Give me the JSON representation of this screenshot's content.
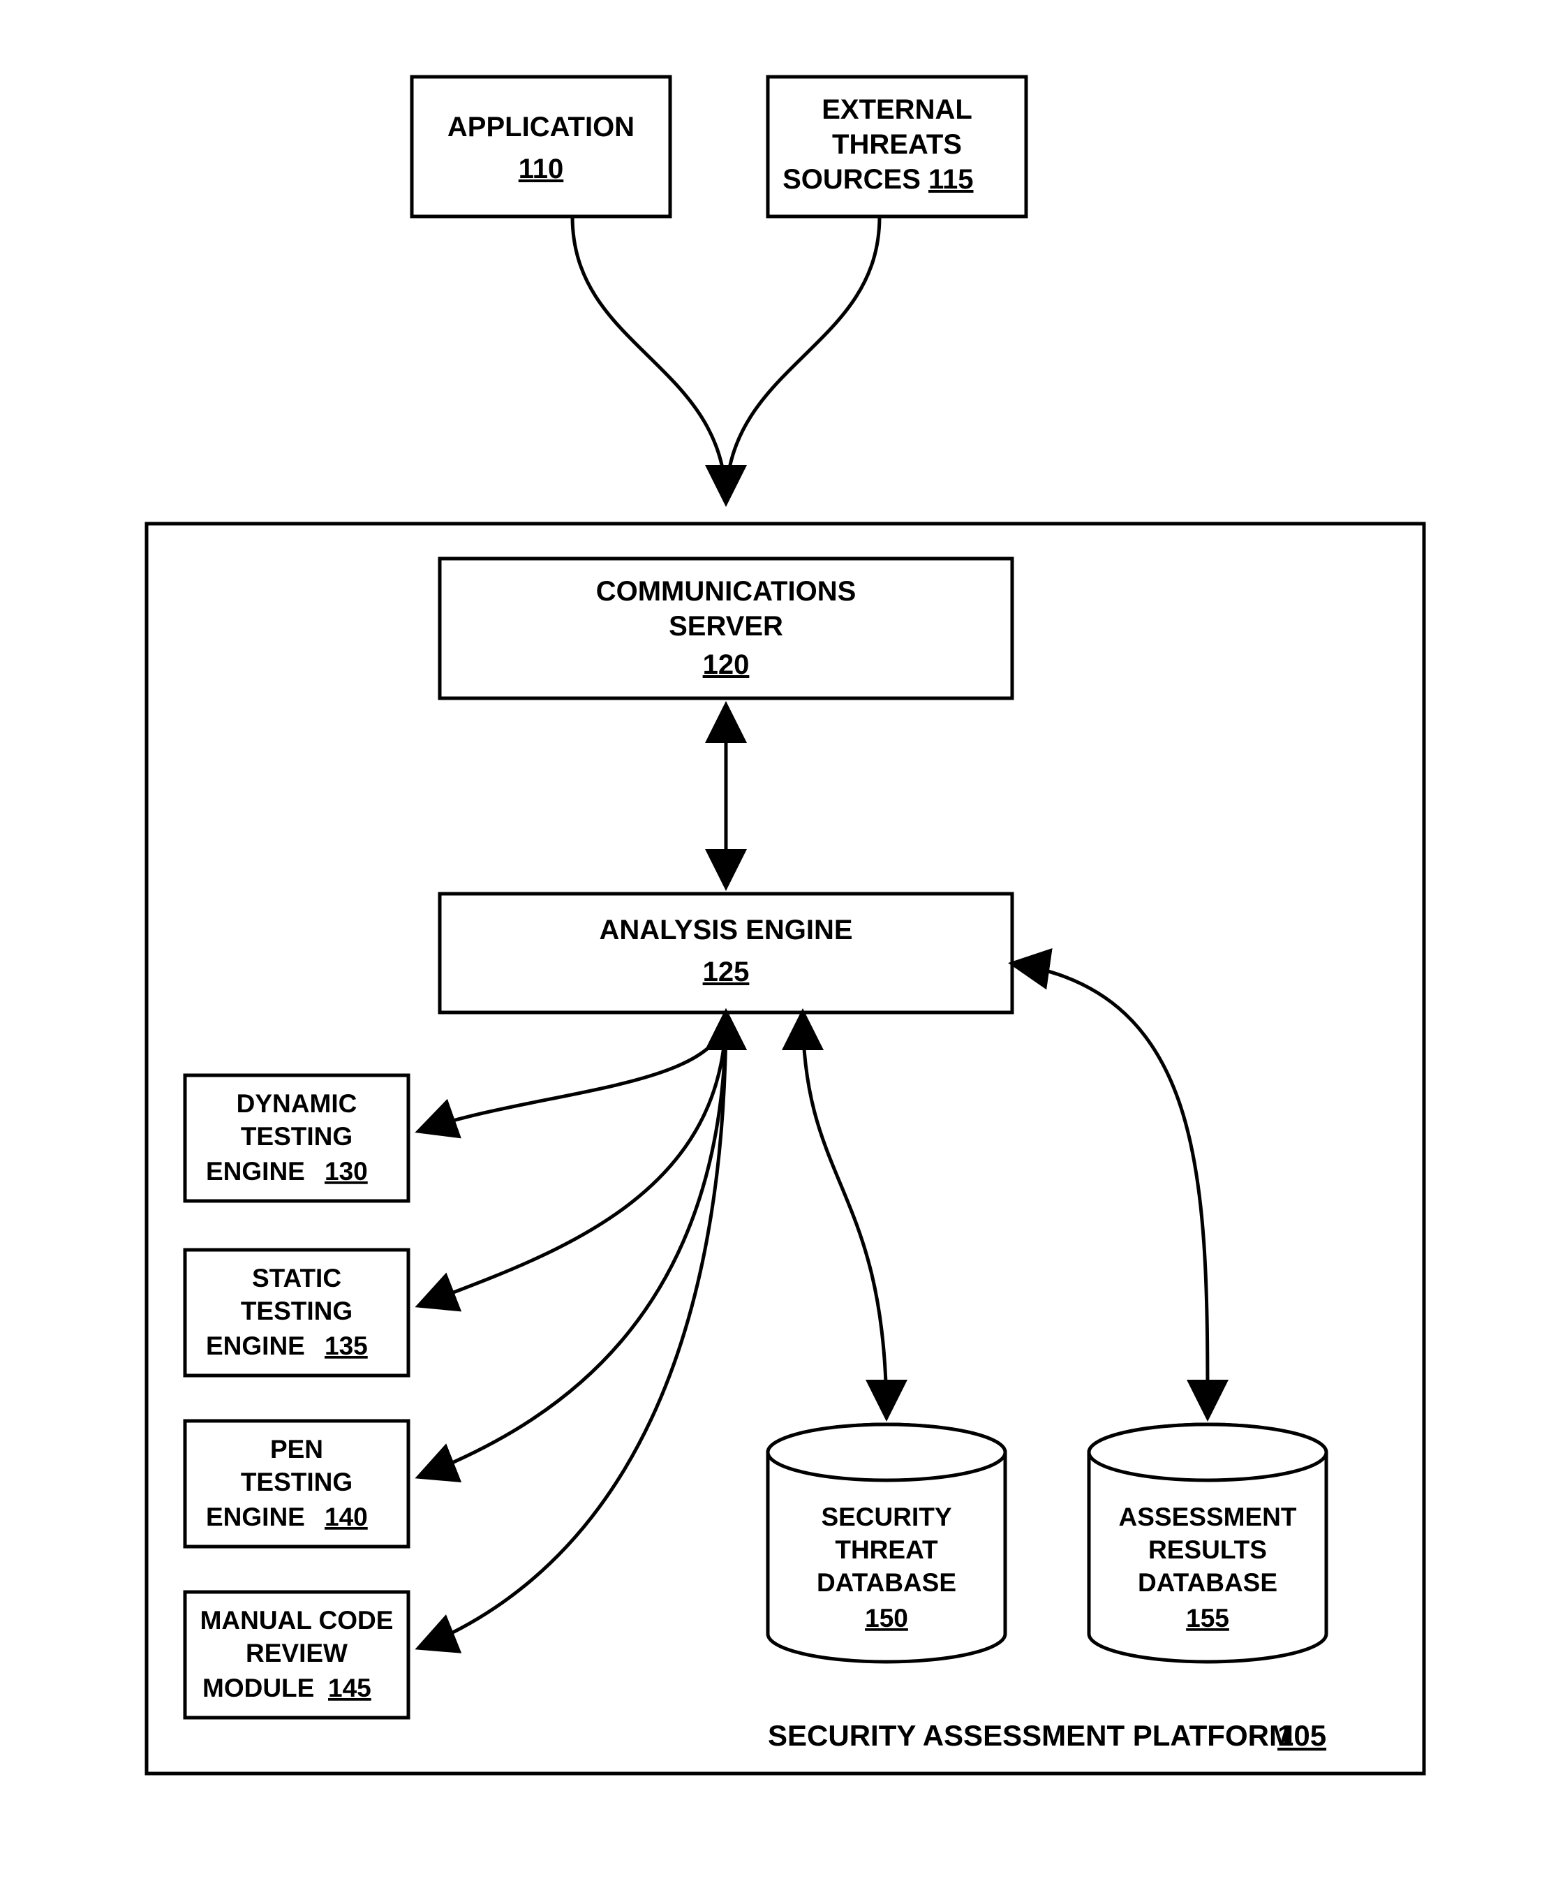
{
  "blocks": {
    "application": {
      "title": "APPLICATION",
      "ref": "110"
    },
    "external_threats": {
      "l1": "EXTERNAL",
      "l2": "THREATS",
      "l3": "SOURCES",
      "ref": "115"
    },
    "comm_server": {
      "l1": "COMMUNICATIONS",
      "l2": "SERVER",
      "ref": "120"
    },
    "analysis_engine": {
      "title": "ANALYSIS ENGINE",
      "ref": "125"
    },
    "dynamic": {
      "l1": "DYNAMIC",
      "l2": "TESTING",
      "l3": "ENGINE",
      "ref": "130"
    },
    "static": {
      "l1": "STATIC",
      "l2": "TESTING",
      "l3": "ENGINE",
      "ref": "135"
    },
    "pen": {
      "l1": "PEN",
      "l2": "TESTING",
      "l3": "ENGINE",
      "ref": "140"
    },
    "manual": {
      "l1": "MANUAL CODE",
      "l2": "REVIEW",
      "l3": "MODULE",
      "ref": "145"
    },
    "threat_db": {
      "l1": "SECURITY",
      "l2": "THREAT",
      "l3": "DATABASE",
      "ref": "150"
    },
    "results_db": {
      "l1": "ASSESSMENT",
      "l2": "RESULTS",
      "l3": "DATABASE",
      "ref": "155"
    },
    "platform": {
      "title": "SECURITY ASSESSMENT PLATFORM",
      "ref": "105"
    }
  }
}
